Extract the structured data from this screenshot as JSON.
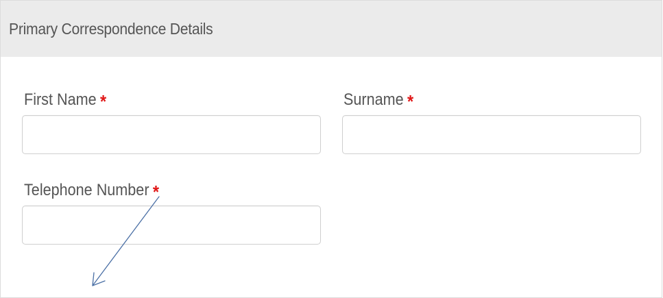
{
  "panel": {
    "title": "Primary Correspondence Details"
  },
  "fields": {
    "first_name": {
      "label": "First Name",
      "required_mark": "*",
      "value": "",
      "placeholder": ""
    },
    "surname": {
      "label": "Surname",
      "required_mark": "*",
      "value": "",
      "placeholder": ""
    },
    "telephone": {
      "label": "Telephone Number",
      "required_mark": "*",
      "value": "",
      "placeholder": ""
    }
  },
  "colors": {
    "header_bg": "#ebebeb",
    "label_text": "#555555",
    "required_mark": "#e01616",
    "input_border": "#cfcfcf",
    "annotation_arrow": "#4a6fa5"
  },
  "annotation": {
    "icon": "arrow-annotation-icon"
  }
}
